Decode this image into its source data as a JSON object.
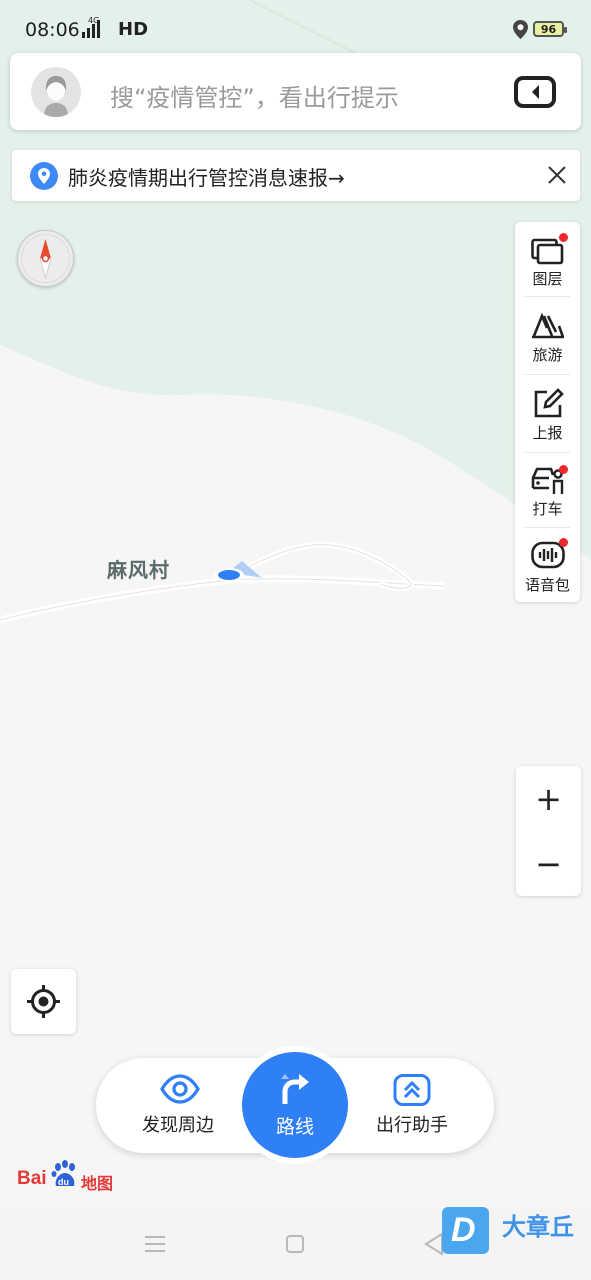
{
  "status": {
    "time": "08:06",
    "network_label": "4G",
    "hd": "HD",
    "battery": "96"
  },
  "search": {
    "placeholder": "搜“疫情管控”，看出行提示"
  },
  "notice": {
    "text": "肺炎疫情期出行管控消息速报→"
  },
  "sidebar": {
    "items": [
      {
        "label": "图层",
        "icon": "layers-icon",
        "badge": true
      },
      {
        "label": "旅游",
        "icon": "travel-icon",
        "badge": false
      },
      {
        "label": "上报",
        "icon": "report-icon",
        "badge": false
      },
      {
        "label": "打车",
        "icon": "taxi-icon",
        "badge": true
      },
      {
        "label": "语音包",
        "icon": "voice-pack-icon",
        "badge": true
      }
    ]
  },
  "map": {
    "place_label": "麻风村"
  },
  "zoom": {
    "in": "+",
    "out": "−"
  },
  "dock": {
    "discover": "发现周边",
    "route": "路线",
    "assistant": "出行助手"
  },
  "brand": {
    "bai": "Bai",
    "du": "du",
    "map": "地图"
  },
  "watermark": {
    "logo": "D",
    "text": "大章丘"
  },
  "colors": {
    "accent": "#2f7ff6",
    "badge": "#f0262d",
    "map_green": "#e3f1ea",
    "map_land": "#f6f6f6"
  }
}
